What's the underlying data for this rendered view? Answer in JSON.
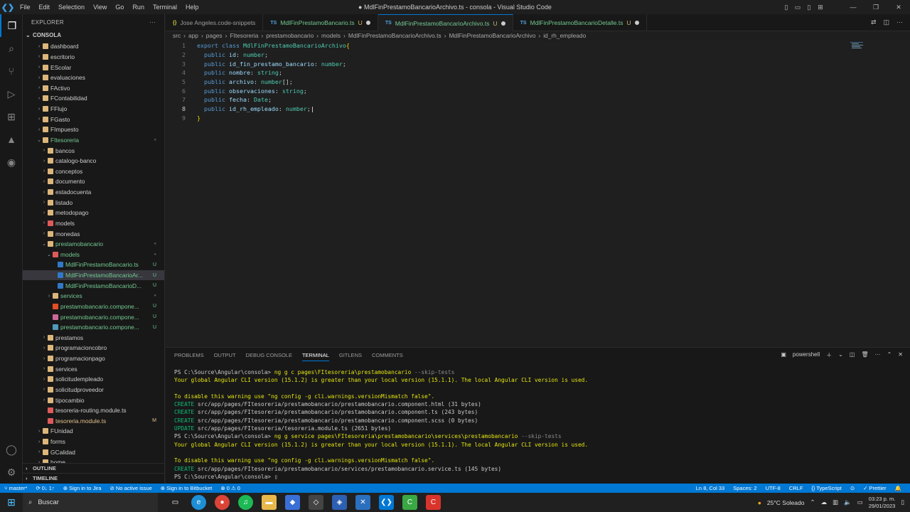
{
  "window": {
    "title": "● MdlFinPrestamoBancarioArchivo.ts - consola - Visual Studio Code"
  },
  "menu": [
    "File",
    "Edit",
    "Selection",
    "View",
    "Go",
    "Run",
    "Terminal",
    "Help"
  ],
  "explorer": {
    "header": "EXPLORER",
    "section": "CONSOLA",
    "outline": "OUTLINE",
    "timeline": "TIMELINE"
  },
  "tree": [
    {
      "label": "dashboard",
      "indent": 2,
      "chev": "›",
      "color": "#dcb67a"
    },
    {
      "label": "escritorio",
      "indent": 2,
      "chev": "›",
      "color": "#dcb67a"
    },
    {
      "label": "EScolar",
      "indent": 2,
      "chev": "›",
      "color": "#dcb67a"
    },
    {
      "label": "evaluaciones",
      "indent": 2,
      "chev": "›",
      "color": "#dcb67a"
    },
    {
      "label": "FActivo",
      "indent": 2,
      "chev": "›",
      "color": "#dcb67a"
    },
    {
      "label": "FContabilidad",
      "indent": 2,
      "chev": "›",
      "color": "#dcb67a"
    },
    {
      "label": "FFlujo",
      "indent": 2,
      "chev": "›",
      "color": "#dcb67a"
    },
    {
      "label": "FGasto",
      "indent": 2,
      "chev": "›",
      "color": "#dcb67a"
    },
    {
      "label": "FImpuesto",
      "indent": 2,
      "chev": "›",
      "color": "#dcb67a"
    },
    {
      "label": "FItesoreria",
      "indent": 2,
      "chev": "⌄",
      "color": "#dcb67a",
      "lcolor": "#73c991",
      "dot": "●"
    },
    {
      "label": "bancos",
      "indent": 3,
      "chev": "›",
      "color": "#dcb67a"
    },
    {
      "label": "catalogo-banco",
      "indent": 3,
      "chev": "›",
      "color": "#dcb67a"
    },
    {
      "label": "conceptos",
      "indent": 3,
      "chev": "›",
      "color": "#dcb67a"
    },
    {
      "label": "documento",
      "indent": 3,
      "chev": "›",
      "color": "#dcb67a"
    },
    {
      "label": "estadocuenta",
      "indent": 3,
      "chev": "›",
      "color": "#dcb67a"
    },
    {
      "label": "listado",
      "indent": 3,
      "chev": "›",
      "color": "#dcb67a"
    },
    {
      "label": "metodopago",
      "indent": 3,
      "chev": "›",
      "color": "#dcb67a"
    },
    {
      "label": "models",
      "indent": 3,
      "chev": "›",
      "color": "#e05a5a"
    },
    {
      "label": "monedas",
      "indent": 3,
      "chev": "›",
      "color": "#dcb67a"
    },
    {
      "label": "prestamobancario",
      "indent": 3,
      "chev": "⌄",
      "color": "#dcb67a",
      "lcolor": "#73c991",
      "dot": "●"
    },
    {
      "label": "models",
      "indent": 4,
      "chev": "⌄",
      "color": "#e05a5a",
      "lcolor": "#73c991",
      "dot": "●"
    },
    {
      "label": "MdlFinPrestamoBancario.ts",
      "indent": 5,
      "chev": "",
      "color": "#3178c6",
      "lcolor": "#73c991",
      "badge": "U"
    },
    {
      "label": "MdlFinPrestamoBancarioAr...",
      "indent": 5,
      "chev": "",
      "color": "#3178c6",
      "lcolor": "#73c991",
      "badge": "U",
      "sel": true
    },
    {
      "label": "MdlFinPrestamoBancarioD...",
      "indent": 5,
      "chev": "",
      "color": "#3178c6",
      "lcolor": "#73c991",
      "badge": "U"
    },
    {
      "label": "services",
      "indent": 4,
      "chev": "›",
      "color": "#dcb67a",
      "lcolor": "#73c991",
      "dot": "●"
    },
    {
      "label": "prestamobancario.compone...",
      "indent": 4,
      "chev": "",
      "color": "#e44d26",
      "lcolor": "#73c991",
      "badge": "U"
    },
    {
      "label": "prestamobancario.compone...",
      "indent": 4,
      "chev": "",
      "color": "#cd6799",
      "lcolor": "#73c991",
      "badge": "U"
    },
    {
      "label": "prestamobancario.compone...",
      "indent": 4,
      "chev": "",
      "color": "#519aba",
      "lcolor": "#73c991",
      "badge": "U"
    },
    {
      "label": "prestamos",
      "indent": 3,
      "chev": "›",
      "color": "#dcb67a"
    },
    {
      "label": "programacioncobro",
      "indent": 3,
      "chev": "›",
      "color": "#dcb67a"
    },
    {
      "label": "programacionpago",
      "indent": 3,
      "chev": "›",
      "color": "#dcb67a"
    },
    {
      "label": "services",
      "indent": 3,
      "chev": "›",
      "color": "#dcb67a"
    },
    {
      "label": "solicitudempleado",
      "indent": 3,
      "chev": "›",
      "color": "#dcb67a"
    },
    {
      "label": "solicitudproveedor",
      "indent": 3,
      "chev": "›",
      "color": "#dcb67a"
    },
    {
      "label": "tipocambio",
      "indent": 3,
      "chev": "›",
      "color": "#dcb67a"
    },
    {
      "label": "tesoreria-routing.module.ts",
      "indent": 3,
      "chev": "",
      "color": "#e05a5a"
    },
    {
      "label": "tesoreria.module.ts",
      "indent": 3,
      "chev": "",
      "color": "#e05a5a",
      "lcolor": "#e2c08d",
      "badge": "M"
    },
    {
      "label": "FUnidad",
      "indent": 2,
      "chev": "›",
      "color": "#dcb67a"
    },
    {
      "label": "forms",
      "indent": 2,
      "chev": "›",
      "color": "#dcb67a"
    },
    {
      "label": "GCalidad",
      "indent": 2,
      "chev": "›",
      "color": "#dcb67a"
    },
    {
      "label": "home",
      "indent": 2,
      "chev": "›",
      "color": "#dcb67a"
    }
  ],
  "tabs": [
    {
      "label": "Jose Angeles.code-snippets",
      "ts": "{}",
      "state": ""
    },
    {
      "label": "MdlFinPrestamoBancario.ts",
      "ts": "TS",
      "state": "U",
      "dot": true
    },
    {
      "label": "MdlFinPrestamoBancarioArchivo.ts",
      "ts": "TS",
      "state": "U",
      "dot": true,
      "active": true
    },
    {
      "label": "MdlFinPrestamoBancarioDetalle.ts",
      "ts": "TS",
      "state": "U",
      "dot": true
    }
  ],
  "breadcrumbs": [
    "src",
    "›",
    "app",
    "›",
    "pages",
    "›",
    "FItesoreria",
    "›",
    "prestamobancario",
    "›",
    "models",
    "›",
    "MdlFinPrestamoBancarioArchivo.ts",
    "›",
    "MdlFinPrestamoBancarioArchivo",
    "›",
    "id_rh_empleado"
  ],
  "code": [
    [
      {
        "t": "export ",
        "c": "kw"
      },
      {
        "t": "class ",
        "c": "kw"
      },
      {
        "t": "MdlFinPrestamoBancarioArchivo",
        "c": "cls"
      },
      {
        "t": "{",
        "c": "brk"
      }
    ],
    [
      {
        "t": "  public ",
        "c": "kw"
      },
      {
        "t": "id",
        "c": "prop"
      },
      {
        "t": ": ",
        "c": "pun"
      },
      {
        "t": "number",
        "c": "typ"
      },
      {
        "t": ";",
        "c": "pun"
      }
    ],
    [
      {
        "t": "  public ",
        "c": "kw"
      },
      {
        "t": "id_fin_prestamo_bancario",
        "c": "prop"
      },
      {
        "t": ": ",
        "c": "pun"
      },
      {
        "t": "number",
        "c": "typ"
      },
      {
        "t": ";",
        "c": "pun"
      }
    ],
    [
      {
        "t": "  public ",
        "c": "kw"
      },
      {
        "t": "nombre",
        "c": "prop"
      },
      {
        "t": ": ",
        "c": "pun"
      },
      {
        "t": "string",
        "c": "typ"
      },
      {
        "t": ";",
        "c": "pun"
      }
    ],
    [
      {
        "t": "  public ",
        "c": "kw"
      },
      {
        "t": "archivo",
        "c": "prop"
      },
      {
        "t": ": ",
        "c": "pun"
      },
      {
        "t": "number",
        "c": "typ"
      },
      {
        "t": "[]",
        "c": "pun"
      },
      {
        "t": ";",
        "c": "pun"
      }
    ],
    [
      {
        "t": "  public ",
        "c": "kw"
      },
      {
        "t": "observaciones",
        "c": "prop"
      },
      {
        "t": ": ",
        "c": "pun"
      },
      {
        "t": "string",
        "c": "typ"
      },
      {
        "t": ";",
        "c": "pun"
      }
    ],
    [
      {
        "t": "  public ",
        "c": "kw"
      },
      {
        "t": "fecha",
        "c": "prop"
      },
      {
        "t": ": ",
        "c": "pun"
      },
      {
        "t": "Date",
        "c": "typ"
      },
      {
        "t": ";",
        "c": "pun"
      }
    ],
    [
      {
        "t": "  public ",
        "c": "kw"
      },
      {
        "t": "id_rh_empleado",
        "c": "prop"
      },
      {
        "t": ": ",
        "c": "pun"
      },
      {
        "t": "number",
        "c": "typ"
      },
      {
        "t": ";",
        "c": "pun"
      }
    ],
    [
      {
        "t": "}",
        "c": "brk"
      }
    ]
  ],
  "current_line": 8,
  "panel": {
    "tabs": [
      "PROBLEMS",
      "OUTPUT",
      "DEBUG CONSOLE",
      "TERMINAL",
      "GITLENS",
      "COMMENTS"
    ],
    "active": "TERMINAL",
    "shell": "powershell",
    "lines": [
      [
        {
          "t": "PS C:\\Source\\Angular\\consola> ",
          "c": "w"
        },
        {
          "t": "ng g c pages\\FItesoreria\\prestamobancario ",
          "c": "y"
        },
        {
          "t": "--skip-tests",
          "c": "d"
        }
      ],
      [
        {
          "t": "Your global Angular CLI version (15.1.2) is greater than your local version (15.1.1). The local Angular CLI version is used.",
          "c": "y"
        }
      ],
      [
        {
          "t": "",
          "c": "w"
        }
      ],
      [
        {
          "t": "To disable this warning use \"ng config -g cli.warnings.versionMismatch false\".",
          "c": "y"
        }
      ],
      [
        {
          "t": "CREATE ",
          "c": "g"
        },
        {
          "t": "src/app/pages/FItesoreria/prestamobancario/prestamobancario.component.html (31 bytes)",
          "c": "w"
        }
      ],
      [
        {
          "t": "CREATE ",
          "c": "g"
        },
        {
          "t": "src/app/pages/FItesoreria/prestamobancario/prestamobancario.component.ts (243 bytes)",
          "c": "w"
        }
      ],
      [
        {
          "t": "CREATE ",
          "c": "g"
        },
        {
          "t": "src/app/pages/FItesoreria/prestamobancario/prestamobancario.component.scss (0 bytes)",
          "c": "w"
        }
      ],
      [
        {
          "t": "UPDATE ",
          "c": "g"
        },
        {
          "t": "src/app/pages/FItesoreria/tesoreria.module.ts (2651 bytes)",
          "c": "w"
        }
      ],
      [
        {
          "t": "PS C:\\Source\\Angular\\consola> ",
          "c": "w"
        },
        {
          "t": "ng g service pages\\FItesoreria\\prestamobancario\\services\\prestamobancario ",
          "c": "y"
        },
        {
          "t": "--skip-tests",
          "c": "d"
        }
      ],
      [
        {
          "t": "Your global Angular CLI version (15.1.2) is greater than your local version (15.1.1). The local Angular CLI version is used.",
          "c": "y"
        }
      ],
      [
        {
          "t": "",
          "c": "w"
        }
      ],
      [
        {
          "t": "To disable this warning use \"ng config -g cli.warnings.versionMismatch false\".",
          "c": "y"
        }
      ],
      [
        {
          "t": "CREATE ",
          "c": "g"
        },
        {
          "t": "src/app/pages/FItesoreria/prestamobancario/services/prestamobancario.service.ts (145 bytes)",
          "c": "w"
        }
      ],
      [
        {
          "t": "PS C:\\Source\\Angular\\consola> ",
          "c": "w"
        },
        {
          "t": "▯",
          "c": "w"
        }
      ]
    ]
  },
  "status": {
    "left": [
      "⑂ master*",
      "⟳ 0↓ 1↑",
      "⊕ Sign in to Jira",
      "⊘ No active issue",
      "⊕ Sign in to Bitbucket",
      "⊗ 0 ⚠ 0"
    ],
    "right": [
      "Ln 8, Col 33",
      "Spaces: 2",
      "UTF-8",
      "CRLF",
      "{} TypeScript",
      "⊙",
      "✓ Prettier",
      "🔔"
    ]
  },
  "taskbar": {
    "search": "Buscar",
    "weather": "25°C Soleado",
    "time": "03:23 p. m.",
    "date": "29/01/2023"
  },
  "colors": {
    "accent": "#0078d4",
    "statusbar": "#0078d4"
  }
}
